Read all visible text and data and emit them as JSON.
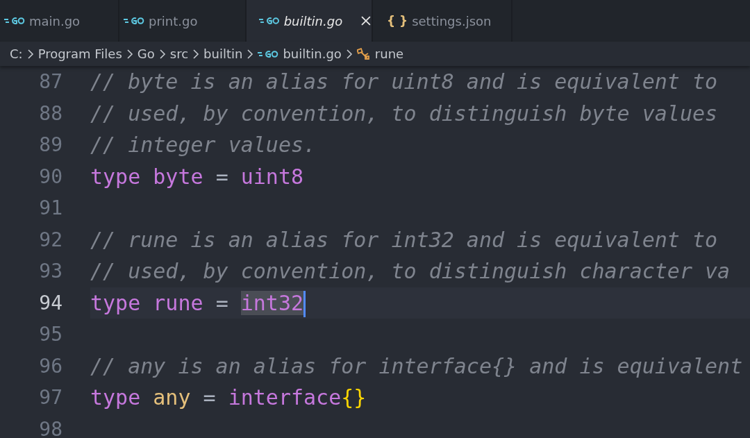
{
  "tabs": [
    {
      "label": "main.go",
      "kind": "go",
      "selected": false
    },
    {
      "label": "print.go",
      "kind": "go",
      "selected": false
    },
    {
      "label": "builtin.go",
      "kind": "go",
      "selected": true
    },
    {
      "label": "settings.json",
      "kind": "json",
      "icon": "{ }",
      "selected": false
    }
  ],
  "breadcrumb": [
    {
      "label": "C:",
      "kind": "folder"
    },
    {
      "label": "Program Files",
      "kind": "folder"
    },
    {
      "label": "Go",
      "kind": "folder"
    },
    {
      "label": "src",
      "kind": "folder"
    },
    {
      "label": "builtin",
      "kind": "folder"
    },
    {
      "label": "builtin.go",
      "kind": "go"
    },
    {
      "label": "rune",
      "kind": "symbol"
    }
  ],
  "lines": [
    {
      "number": "87",
      "current": false,
      "tokens": [
        {
          "kind": "comment",
          "text": "// byte is an alias for uint8 and is equivalent to"
        }
      ]
    },
    {
      "number": "88",
      "current": false,
      "tokens": [
        {
          "kind": "comment",
          "text": "// used, by convention, to distinguish byte values"
        }
      ]
    },
    {
      "number": "89",
      "current": false,
      "tokens": [
        {
          "kind": "comment",
          "text": "// integer values."
        }
      ]
    },
    {
      "number": "90",
      "current": false,
      "tokens": [
        {
          "kind": "keyword",
          "text": "type"
        },
        {
          "kind": "keyword",
          "text": "byte"
        },
        {
          "kind": "operator",
          "text": "="
        },
        {
          "kind": "keyword",
          "text": "uint8"
        }
      ]
    },
    {
      "number": "91",
      "current": false
    },
    {
      "number": "92",
      "current": false,
      "tokens": [
        {
          "kind": "comment",
          "text": "// rune is an alias for int32 and is equivalent to"
        }
      ]
    },
    {
      "number": "93",
      "current": false,
      "tokens": [
        {
          "kind": "comment",
          "text": "// used, by convention, to distinguish character va"
        }
      ]
    },
    {
      "number": "94",
      "current": true,
      "tokens": [
        {
          "kind": "keyword",
          "text": "type"
        },
        {
          "kind": "keyword",
          "text": "rune"
        },
        {
          "kind": "operator",
          "text": "="
        }
      ],
      "selection": {
        "kind": "keyword",
        "text": "int32"
      }
    },
    {
      "number": "95",
      "current": false
    },
    {
      "number": "96",
      "current": false,
      "tokens": [
        {
          "kind": "comment",
          "text": "// any is an alias for interface{} and is equivalent"
        }
      ]
    },
    {
      "number": "97",
      "current": false,
      "tokens": [
        {
          "kind": "keyword",
          "text": "type"
        },
        {
          "kind": "type",
          "text": "any"
        },
        {
          "kind": "operator",
          "text": "="
        },
        {
          "kind": "keyword",
          "text": "interface"
        },
        {
          "kind": "bracket",
          "text": "{}"
        }
      ]
    },
    {
      "number": "98",
      "current": false
    }
  ]
}
